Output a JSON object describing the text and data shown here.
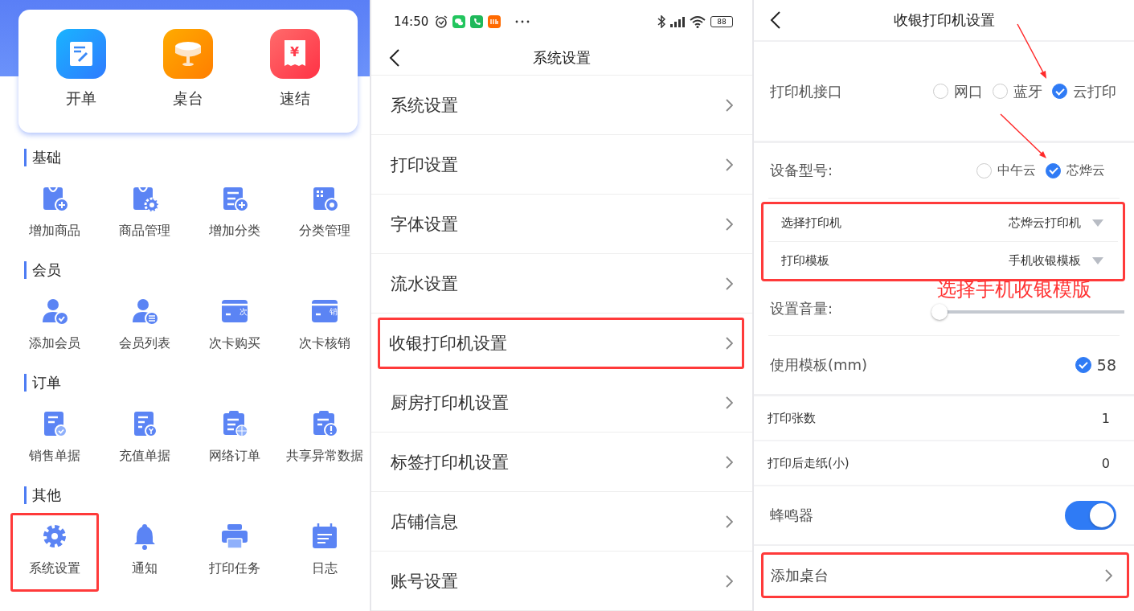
{
  "home": {
    "quick_actions": [
      {
        "label": "开单",
        "kind": "order"
      },
      {
        "label": "桌台",
        "kind": "table"
      },
      {
        "label": "速结",
        "kind": "receipt",
        "badge": "¥"
      }
    ],
    "sections": [
      {
        "title": "基础",
        "items": [
          {
            "label": "增加商品",
            "kind": "bag-plus",
            "highlighted": false
          },
          {
            "label": "商品管理",
            "kind": "bag-gear",
            "highlighted": false
          },
          {
            "label": "增加分类",
            "kind": "list-plus",
            "highlighted": false
          },
          {
            "label": "分类管理",
            "kind": "grid-target",
            "highlighted": false
          }
        ]
      },
      {
        "title": "会员",
        "items": [
          {
            "label": "添加会员",
            "kind": "user-check",
            "highlighted": false
          },
          {
            "label": "会员列表",
            "kind": "user-list",
            "highlighted": false
          },
          {
            "label": "次卡购买",
            "kind": "card",
            "badge": "次",
            "highlighted": false
          },
          {
            "label": "次卡核销",
            "kind": "card",
            "badge": "销",
            "highlighted": false
          }
        ]
      },
      {
        "title": "订单",
        "items": [
          {
            "label": "销售单据",
            "kind": "doc-check",
            "highlighted": false
          },
          {
            "label": "充值单据",
            "kind": "doc-coin",
            "highlighted": false
          },
          {
            "label": "网络订单",
            "kind": "doc-globe",
            "highlighted": false
          },
          {
            "label": "共享异常数据",
            "kind": "doc-alert",
            "highlighted": false
          }
        ]
      },
      {
        "title": "其他",
        "items": [
          {
            "label": "系统设置",
            "kind": "gear",
            "highlighted": true
          },
          {
            "label": "通知",
            "kind": "bell",
            "highlighted": false
          },
          {
            "label": "打印任务",
            "kind": "printer",
            "highlighted": false
          },
          {
            "label": "日志",
            "kind": "calendar",
            "highlighted": false
          }
        ]
      }
    ]
  },
  "status_bar": {
    "time": "14:50",
    "battery": "88"
  },
  "settings_menu": {
    "title": "系统设置",
    "items": [
      {
        "label": "系统设置",
        "highlighted": false
      },
      {
        "label": "打印设置",
        "highlighted": false
      },
      {
        "label": "字体设置",
        "highlighted": false
      },
      {
        "label": "流水设置",
        "highlighted": false
      },
      {
        "label": "收银打印机设置",
        "highlighted": true
      },
      {
        "label": "厨房打印机设置",
        "highlighted": false
      },
      {
        "label": "标签打印机设置",
        "highlighted": false
      },
      {
        "label": "店铺信息",
        "highlighted": false
      },
      {
        "label": "账号设置",
        "highlighted": false
      }
    ]
  },
  "printer_settings": {
    "title": "收银打印机设置",
    "interface": {
      "label": "打印机接口",
      "options": [
        {
          "label": "网口",
          "selected": false
        },
        {
          "label": "蓝牙",
          "selected": false
        },
        {
          "label": "云打印",
          "selected": true
        }
      ]
    },
    "device_model": {
      "label": "设备型号:",
      "options": [
        {
          "label": "中午云",
          "selected": false
        },
        {
          "label": "芯烨云",
          "selected": true
        }
      ]
    },
    "dropdowns": {
      "highlighted": true,
      "rows": [
        {
          "label": "选择打印机",
          "value": "芯烨云打印机"
        },
        {
          "label": "打印模板",
          "value": "手机收银模板"
        }
      ]
    },
    "annotation": "选择手机收银模版",
    "volume": {
      "label": "设置音量:",
      "level": 0
    },
    "template": {
      "label": "使用模板(mm)",
      "value": "58",
      "checked": true
    },
    "copies": {
      "label": "打印张数",
      "value": "1"
    },
    "paper_feed": {
      "label": "打印后走纸(小)",
      "value": "0"
    },
    "buzzer": {
      "label": "蜂鸣器",
      "on": true
    },
    "add_table": {
      "label": "添加桌台",
      "highlighted": true
    }
  }
}
